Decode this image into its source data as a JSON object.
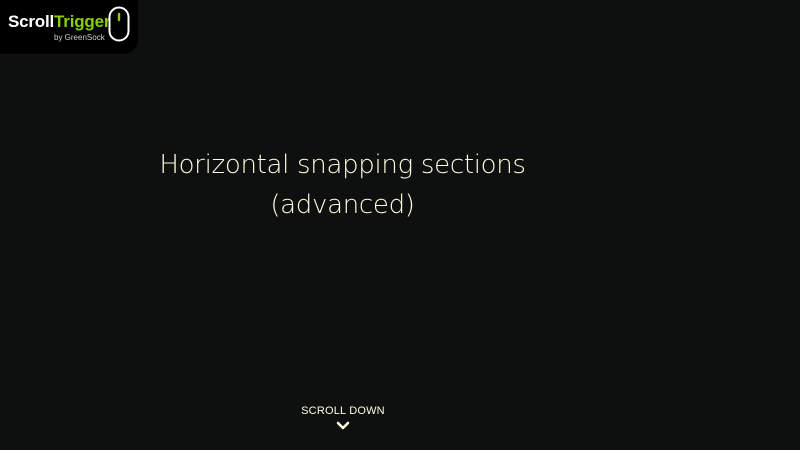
{
  "logo": {
    "word_scroll": "Scroll",
    "word_trigger": "Trigger",
    "byline": "by GreenSock",
    "icon": "mouse-icon",
    "accent_color": "#88ce02"
  },
  "main": {
    "title_line_1": "Horizontal snapping sections",
    "title_line_2": "(advanced)"
  },
  "scroll_hint": {
    "label": "SCROLL DOWN",
    "icon": "chevron-down-icon"
  },
  "colors": {
    "background": "#0e100f",
    "text": "#fffce1",
    "brand_green": "#88ce02"
  }
}
